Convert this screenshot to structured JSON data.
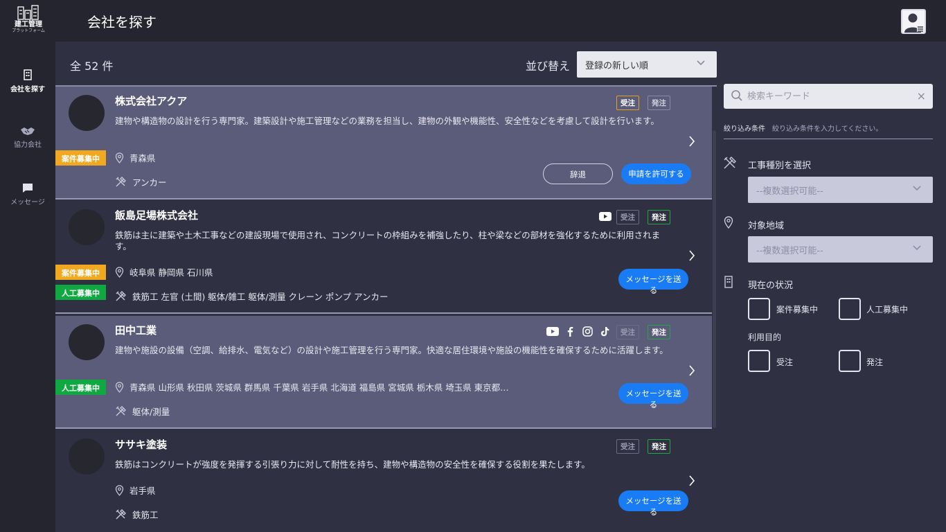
{
  "app": {
    "logo_text": "建工管理",
    "logo_sub": "プラットフォーム",
    "page_title": "会社を探す"
  },
  "sidebar": {
    "items": [
      {
        "label": "会社を探す",
        "icon": "building-icon"
      },
      {
        "label": "協力会社",
        "icon": "handshake-icon"
      },
      {
        "label": "メッセージ",
        "icon": "chat-icon"
      }
    ]
  },
  "list_header": {
    "count": "全 52 件",
    "sort_label": "並び替え",
    "sort_value": "登録の新しい順"
  },
  "cards": [
    {
      "name": "株式会社アクア",
      "description": "建物や構造物の設計を行う専門家。建築設計や施工管理などの業務を担当し、建物の外観や機能性、安全性などを考慮して設計を行います。",
      "location": "青森県",
      "trades": "アンカー",
      "status_tags": [
        "案件募集中"
      ],
      "badge_juchu": "受注",
      "badge_hatchu": "発注",
      "decline_button": "辞退",
      "primary_button": "申請を許可する"
    },
    {
      "name": "飯島足場株式会社",
      "description": "鉄筋は主に建築や土木工事などの建設現場で使用され、コンクリートの枠組みを補強したり、柱や梁などの部材を強化するために利用されます。",
      "location": "岐阜県 静岡県 石川県",
      "trades": "鉄筋工 左官 (土間) 躯体/雑工 躯体/測量 クレーン ポンプ アンカー",
      "status_tags": [
        "案件募集中",
        "人工募集中"
      ],
      "badge_juchu": "受注",
      "badge_hatchu": "発注",
      "primary_button": "メッセージを送る"
    },
    {
      "name": "田中工業",
      "description": "建物や施設の設備（空調、給排水、電気など）の設計や施工管理を行う専門家。快適な居住環境や施設の機能性を確保するために活躍します。",
      "location": "青森県 山形県 秋田県 茨城県 群馬県 千葉県 岩手県 北海道 福島県 宮城県 栃木県 埼玉県 東京都…",
      "trades": "躯体/測量",
      "status_tags": [
        "人工募集中"
      ],
      "badge_juchu": "受注",
      "badge_hatchu": "発注",
      "primary_button": "メッセージを送る"
    },
    {
      "name": "ササキ塗装",
      "description": "鉄筋はコンクリートが強度を発揮する引張り力に対して耐性を持ち、建物や構造物の安全性を確保する役割を果たします。",
      "location": "岩手県",
      "trades": "鉄筋工",
      "status_tags": [],
      "badge_juchu": "受注",
      "badge_hatchu": "発注",
      "primary_button": "メッセージを送る"
    }
  ],
  "filters": {
    "search_placeholder": "検索キーワード",
    "condition_label": "絞り込み条件",
    "condition_hint": "絞り込み条件を入力してください。",
    "trade_label": "工事種別を選択",
    "trade_placeholder": "--複数選択可能--",
    "region_label": "対象地域",
    "region_placeholder": "--複数選択可能--",
    "status_label": "現在の状況",
    "status_options": [
      "案件募集中",
      "人工募集中"
    ],
    "purpose_label": "利用目的",
    "purpose_options": [
      "受注",
      "発注"
    ]
  },
  "colors": {
    "primary_blue": "#1a7cf5",
    "tag_yellow": "#f0a820",
    "tag_green": "#10a840",
    "card_highlight": "#5b5c7a",
    "background": "#2f3041"
  }
}
